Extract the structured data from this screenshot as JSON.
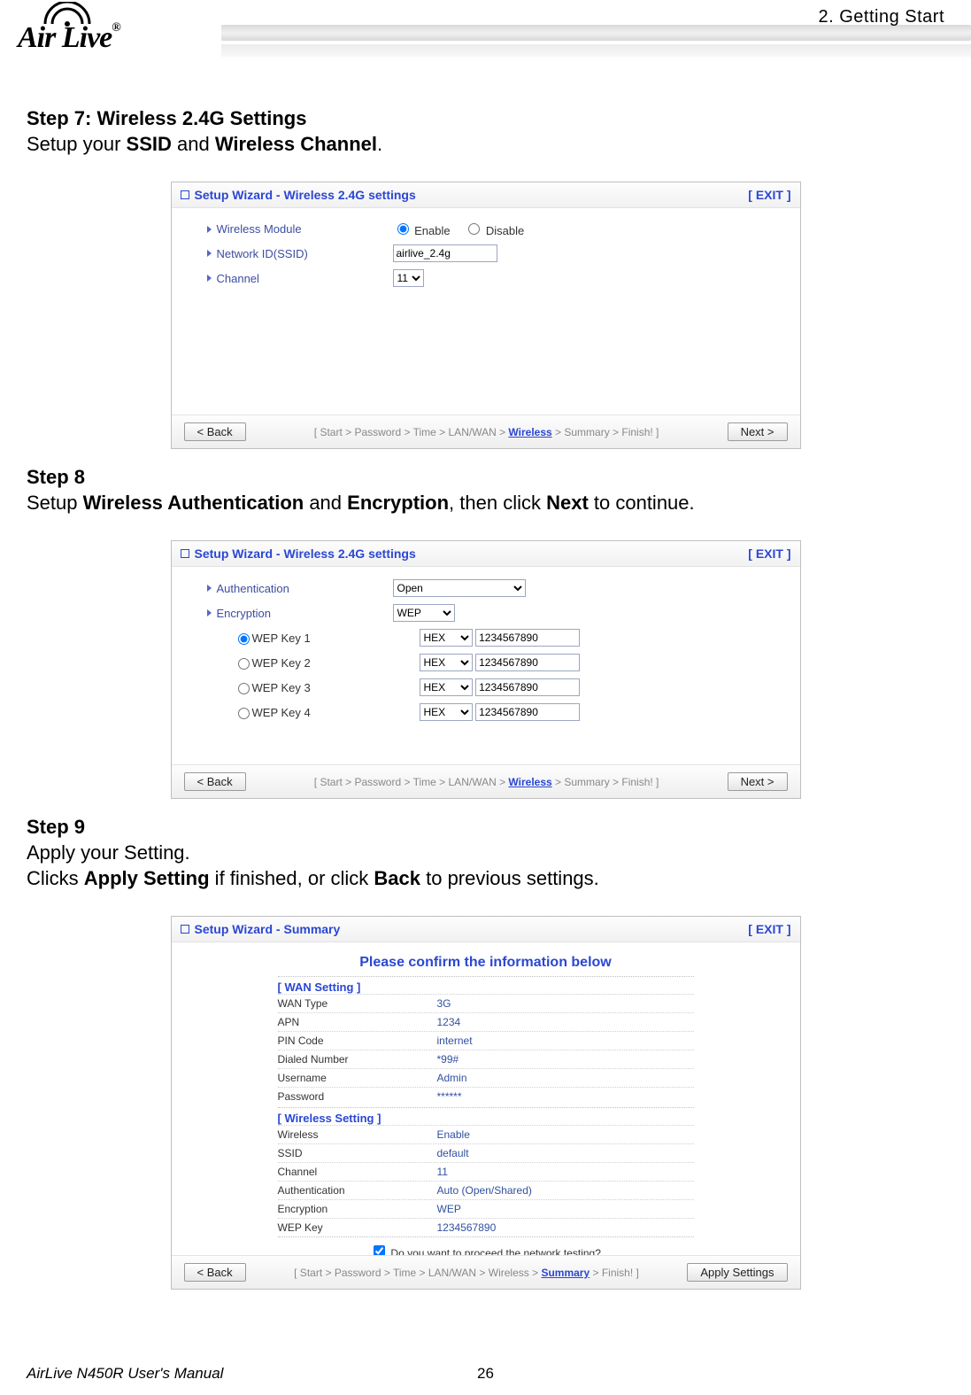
{
  "header": {
    "logo_text": "Air Live",
    "reg_mark": "®",
    "page_header": "2. Getting Start"
  },
  "step7": {
    "title": "Step 7: Wireless 2.4G Settings",
    "subtitle_prefix": "Setup your ",
    "subtitle_b1": "SSID",
    "subtitle_mid": " and ",
    "subtitle_b2": "Wireless Channel",
    "subtitle_suffix": ".",
    "shot_title": "Setup Wizard - Wireless 2.4G settings",
    "exit": "[ EXIT ]",
    "wireless_module_label": "Wireless Module",
    "enable": "Enable",
    "disable": "Disable",
    "ssid_label": "Network ID(SSID)",
    "ssid_value": "airlive_2.4g",
    "channel_label": "Channel",
    "channel_value": "11",
    "back": "< Back",
    "next": "Next >",
    "breadcrumb": "[ Start > Password > Time > LAN/WAN > Wireless > Summary > Finish! ]",
    "breadcrumb_pre": "[ Start > Password > Time > LAN/WAN > ",
    "breadcrumb_active": "Wireless",
    "breadcrumb_post": " > Summary > Finish! ]"
  },
  "step8": {
    "title": "Step 8",
    "line_prefix": "Setup ",
    "line_b1": "Wireless Authentication",
    "line_mid1": " and ",
    "line_b2": "Encryption",
    "line_mid2": ", then click ",
    "line_b3": "Next",
    "line_suffix": " to continue.",
    "shot_title": "Setup Wizard - Wireless 2.4G settings",
    "exit": "[ EXIT ]",
    "auth_label": "Authentication",
    "auth_value": "Open",
    "enc_label": "Encryption",
    "enc_value": "WEP",
    "wep_keys": [
      {
        "label": "WEP Key 1",
        "type": "HEX",
        "value": "1234567890"
      },
      {
        "label": "WEP Key 2",
        "type": "HEX",
        "value": "1234567890"
      },
      {
        "label": "WEP Key 3",
        "type": "HEX",
        "value": "1234567890"
      },
      {
        "label": "WEP Key 4",
        "type": "HEX",
        "value": "1234567890"
      }
    ],
    "back": "< Back",
    "next": "Next >",
    "breadcrumb_pre": "[ Start > Password > Time > LAN/WAN > ",
    "breadcrumb_active": "Wireless",
    "breadcrumb_post": " > Summary > Finish! ]"
  },
  "step9": {
    "title": "Step 9",
    "line1": "Apply your Setting.",
    "line2_prefix": "Clicks ",
    "line2_b1": "Apply Setting",
    "line2_mid": " if finished, or click ",
    "line2_b2": "Back",
    "line2_suffix": " to previous settings.",
    "shot_title": "Setup Wizard - Summary",
    "exit": "[ EXIT ]",
    "confirm_heading": "Please confirm the information below",
    "wan_heading": "[ WAN Setting ]",
    "wireless_heading": "[ Wireless Setting ]",
    "summary_wan": [
      {
        "k": "WAN Type",
        "v": "3G"
      },
      {
        "k": "APN",
        "v": "1234"
      },
      {
        "k": "PIN Code",
        "v": "internet"
      },
      {
        "k": "Dialed Number",
        "v": "*99#"
      },
      {
        "k": "Username",
        "v": "Admin"
      },
      {
        "k": "Password",
        "v": "******"
      }
    ],
    "summary_wl": [
      {
        "k": "Wireless",
        "v": "Enable"
      },
      {
        "k": "SSID",
        "v": "default"
      },
      {
        "k": "Channel",
        "v": "11"
      },
      {
        "k": "Authentication",
        "v": "Auto (Open/Shared)"
      },
      {
        "k": "Encryption",
        "v": "WEP"
      },
      {
        "k": "WEP Key",
        "v": "1234567890"
      }
    ],
    "proceed_check": "Do you want to proceed the network testing?",
    "back": "< Back",
    "apply": "Apply Settings",
    "breadcrumb_pre": "[ Start > Password > Time > LAN/WAN > Wireless > ",
    "breadcrumb_active": "Summary",
    "breadcrumb_post": " > Finish! ]"
  },
  "footer": {
    "manual": "AirLive N450R User's Manual",
    "page_no": "26"
  }
}
